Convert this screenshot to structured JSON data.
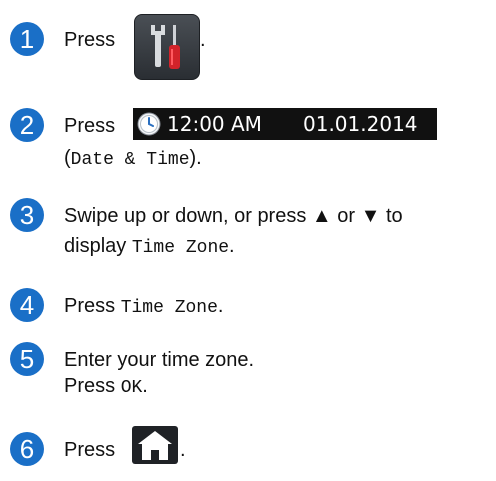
{
  "steps": [
    {
      "number": "1",
      "lead": "Press",
      "trail": ".",
      "icon": "tools-icon"
    },
    {
      "number": "2",
      "lead": "Press",
      "time": "12:00 AM",
      "date": "01.01.2014",
      "line2_open": "(",
      "line2_mono": "Date & Time",
      "line2_close": ").",
      "icon": "clock-icon"
    },
    {
      "number": "3",
      "line1": "Swipe up or down, or press ▲ or ▼ to",
      "line2_text": "display",
      "line2_mono": "Time Zone",
      "line2_end": "."
    },
    {
      "number": "4",
      "lead": "Press",
      "mono": "Time Zone",
      "end": "."
    },
    {
      "number": "5",
      "line1": "Enter your time zone.",
      "line2_text": "Press",
      "line2_mono": "OK",
      "line2_end": "."
    },
    {
      "number": "6",
      "lead": "Press",
      "trail": ".",
      "icon": "home-icon"
    }
  ],
  "colors": {
    "step_circle": "#1a6fc7",
    "text": "#111111",
    "date_strip": "#111111"
  }
}
